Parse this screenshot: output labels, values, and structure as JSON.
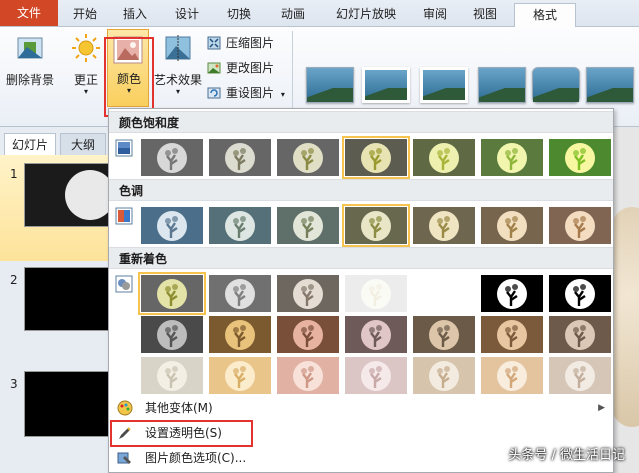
{
  "tabs": [
    "文件",
    "开始",
    "插入",
    "设计",
    "切换",
    "动画",
    "幻灯片放映",
    "审阅",
    "视图",
    "格式"
  ],
  "ribbon": {
    "remove_bg": "删除背景",
    "correct": "更正",
    "color": "颜色",
    "artistic": "艺术效果",
    "compress": "压缩图片",
    "change": "更改图片",
    "reset": "重设图片"
  },
  "left_pane": {
    "tab_slides": "幻灯片",
    "tab_outline": "大纲",
    "slide_numbers": [
      "1",
      "2",
      "3"
    ]
  },
  "dropdown": {
    "saturation_header": "颜色饱和度",
    "tone_header": "色调",
    "recolor_header": "重新着色",
    "more_variants": "其他变体(M)",
    "set_transparent": "设置透明色(S)",
    "color_options": "图片颜色选项(C)..."
  },
  "watermark": "头条号 / 微生活日记",
  "colors": {
    "accent_file": "#d24726",
    "selection": "#f5c34e",
    "highlight_red": "#e2332e"
  }
}
